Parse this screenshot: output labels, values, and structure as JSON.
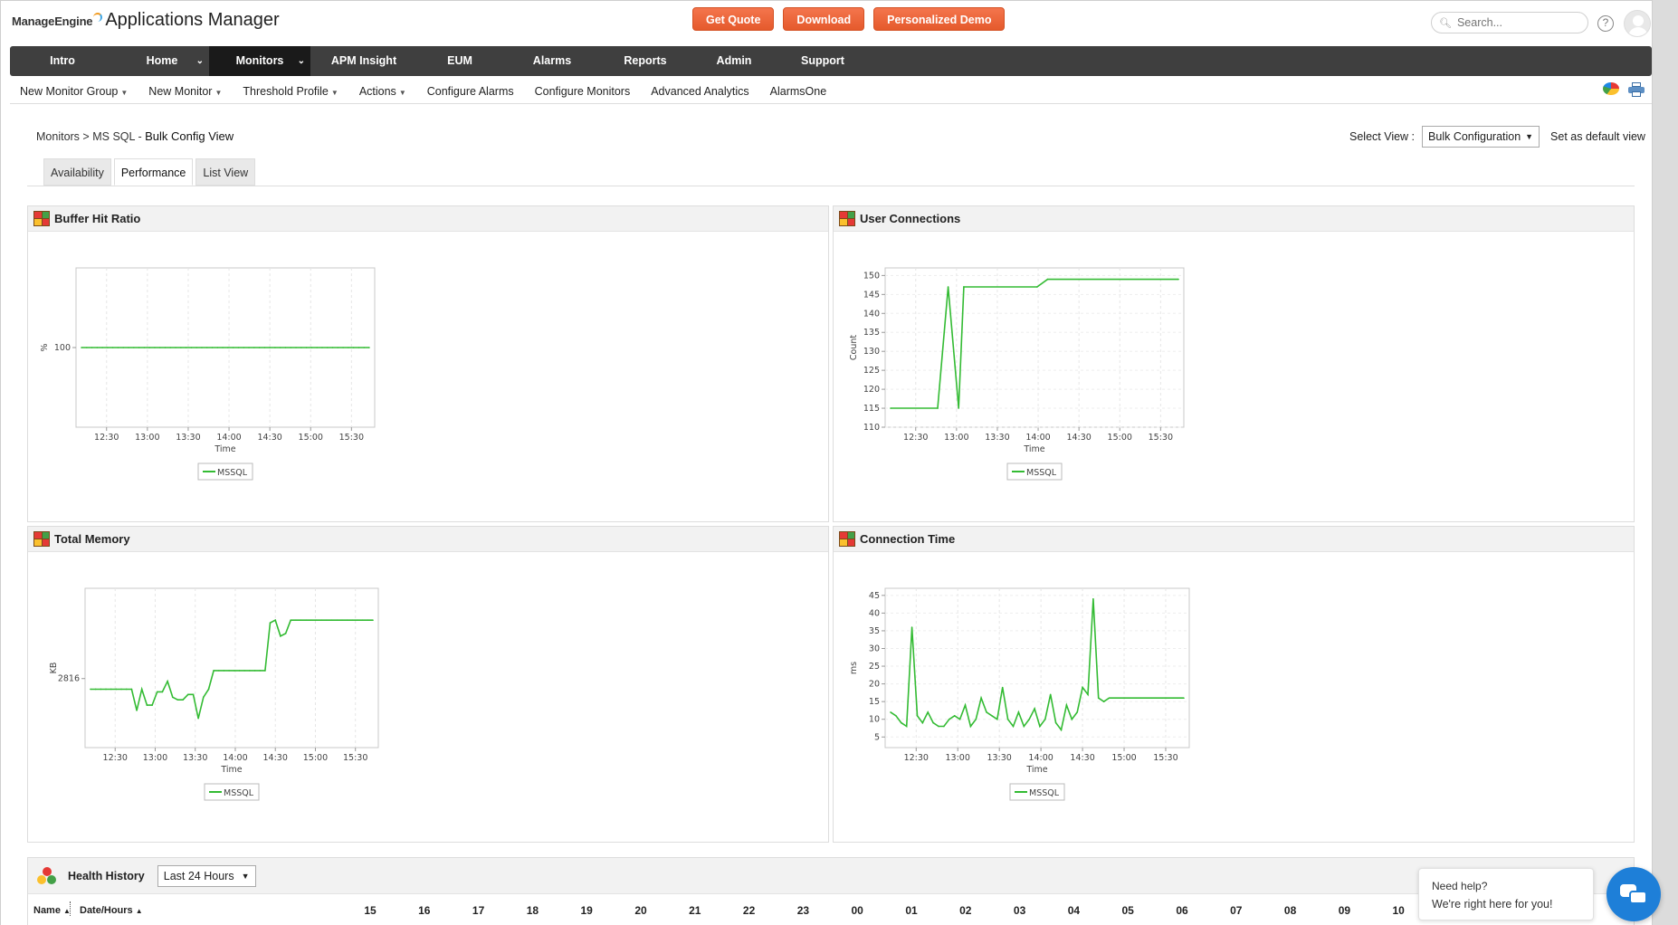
{
  "header": {
    "brand_company": "ManageEngine",
    "brand_product": "Applications Manager",
    "buttons": [
      "Get Quote",
      "Download",
      "Personalized Demo"
    ],
    "search_placeholder": "Search...",
    "help_glyph": "?",
    "accent_color": "#e55a2c"
  },
  "main_nav": [
    {
      "label": "Intro",
      "active": false,
      "chevron": false
    },
    {
      "label": "Home",
      "active": false,
      "chevron": true
    },
    {
      "label": "Monitors",
      "active": true,
      "chevron": true
    },
    {
      "label": "APM Insight",
      "active": false,
      "chevron": false
    },
    {
      "label": "EUM",
      "active": false,
      "chevron": false
    },
    {
      "label": "Alarms",
      "active": false,
      "chevron": false
    },
    {
      "label": "Reports",
      "active": false,
      "chevron": false
    },
    {
      "label": "Admin",
      "active": false,
      "chevron": false
    },
    {
      "label": "Support",
      "active": false,
      "chevron": false
    }
  ],
  "sub_nav": [
    {
      "label": "New Monitor Group",
      "dropdown": true
    },
    {
      "label": "New Monitor",
      "dropdown": true
    },
    {
      "label": "Threshold Profile",
      "dropdown": true
    },
    {
      "label": "Actions",
      "dropdown": true
    },
    {
      "label": "Configure Alarms",
      "dropdown": false
    },
    {
      "label": "Configure Monitors",
      "dropdown": false
    },
    {
      "label": "Advanced Analytics",
      "dropdown": false
    },
    {
      "label": "AlarmsOne",
      "dropdown": false
    }
  ],
  "breadcrumb": {
    "root": "Monitors",
    "separator": ">",
    "type": "MS SQL",
    "dash": "-",
    "page": "Bulk Config View"
  },
  "view_select": {
    "label": "Select View :",
    "value": "Bulk Configuration",
    "default_link": "Set as default view"
  },
  "tabs": [
    {
      "label": "Availability",
      "active": false
    },
    {
      "label": "Performance",
      "active": true
    },
    {
      "label": "List View",
      "active": false
    }
  ],
  "health_history": {
    "title": "Health History",
    "period": "Last 24 Hours",
    "col_name": "Name",
    "col_date": "Date/Hours",
    "hours": [
      "15",
      "16",
      "17",
      "18",
      "19",
      "20",
      "21",
      "22",
      "23",
      "00",
      "01",
      "02",
      "03",
      "04",
      "05",
      "06",
      "07",
      "08",
      "09",
      "10"
    ]
  },
  "help_widget": {
    "line1": "Need help?",
    "line2": "We're right here for you!"
  },
  "chart_data": [
    {
      "type": "line",
      "title": "Buffer Hit Ratio",
      "ylabel": "%",
      "xlabel": "Time",
      "x_ticks": [
        "12:30",
        "13:00",
        "13:30",
        "14:00",
        "14:30",
        "15:00",
        "15:30"
      ],
      "y_ticks": [
        100
      ],
      "ylim": [
        60,
        140
      ],
      "series": [
        {
          "name": "MSSQL",
          "color": "#33bb33",
          "x": [
            0,
            1,
            2,
            3,
            4,
            5,
            6,
            7,
            8,
            9,
            10,
            11,
            12,
            13,
            14,
            15,
            16,
            17,
            18,
            19,
            20,
            21,
            22,
            23,
            24,
            25,
            26,
            27,
            28,
            29,
            30,
            31,
            32,
            33,
            34,
            35,
            36,
            37,
            38,
            39,
            40,
            41,
            42,
            43,
            44,
            45,
            46,
            47,
            48,
            49,
            50,
            51,
            52,
            53,
            54,
            55
          ],
          "y": [
            100,
            100,
            100,
            100,
            100,
            100,
            100,
            100,
            100,
            100,
            100,
            100,
            100,
            100,
            100,
            100,
            100,
            100,
            100,
            100,
            100,
            100,
            100,
            100,
            100,
            100,
            100,
            100,
            100,
            100,
            100,
            100,
            100,
            100,
            100,
            100,
            100,
            100,
            100,
            100,
            100,
            100,
            100,
            100,
            100,
            100,
            100,
            100,
            100,
            100,
            100,
            100,
            100,
            100,
            100,
            100
          ]
        }
      ]
    },
    {
      "type": "line",
      "title": "User Connections",
      "ylabel": "Count",
      "xlabel": "Time",
      "x_ticks": [
        "12:30",
        "13:00",
        "13:30",
        "14:00",
        "14:30",
        "15:00",
        "15:30"
      ],
      "y_ticks": [
        110,
        115,
        120,
        125,
        130,
        135,
        140,
        145,
        150
      ],
      "ylim": [
        110,
        152
      ],
      "series": [
        {
          "name": "MSSQL",
          "color": "#33bb33",
          "x": [
            0,
            9,
            11,
            13,
            14,
            28,
            30,
            55
          ],
          "y": [
            115,
            115,
            147,
            115,
            147,
            147,
            149,
            149
          ]
        }
      ]
    },
    {
      "type": "line",
      "title": "Total Memory",
      "ylabel": "KB",
      "xlabel": "Time",
      "x_ticks": [
        "12:30",
        "13:00",
        "13:30",
        "14:00",
        "14:30",
        "15:00",
        "15:30"
      ],
      "y_ticks": [
        2816
      ],
      "ylim": [
        2790,
        2850
      ],
      "series": [
        {
          "name": "MSSQL",
          "color": "#33bb33",
          "x": [
            0,
            1,
            2,
            3,
            4,
            5,
            6,
            7,
            8,
            9,
            10,
            11,
            12,
            13,
            14,
            15,
            16,
            17,
            18,
            19,
            20,
            21,
            22,
            23,
            24,
            25,
            26,
            27,
            28,
            29,
            30,
            31,
            32,
            33,
            34,
            35,
            36,
            37,
            38,
            39,
            40,
            41,
            42,
            43,
            44,
            45,
            46,
            47,
            48,
            49,
            50,
            51,
            52,
            53,
            54,
            55
          ],
          "y": [
            2812,
            2812,
            2812,
            2812,
            2812,
            2812,
            2812,
            2812,
            2812,
            2804,
            2812,
            2806,
            2806,
            2811,
            2811,
            2815,
            2809,
            2808,
            2808,
            2810,
            2810,
            2801,
            2809,
            2812,
            2819,
            2819,
            2819,
            2819,
            2819,
            2819,
            2819,
            2819,
            2819,
            2819,
            2819,
            2837,
            2838,
            2832,
            2833,
            2838,
            2838,
            2838,
            2838,
            2838,
            2838,
            2838,
            2838,
            2838,
            2838,
            2838,
            2838,
            2838,
            2838,
            2838,
            2838,
            2838
          ]
        }
      ]
    },
    {
      "type": "line",
      "title": "Connection Time",
      "ylabel": "ms",
      "xlabel": "Time",
      "x_ticks": [
        "12:30",
        "13:00",
        "13:30",
        "14:00",
        "14:30",
        "15:00",
        "15:30"
      ],
      "y_ticks": [
        5,
        10,
        15,
        20,
        25,
        30,
        35,
        40,
        45
      ],
      "ylim": [
        2,
        47
      ],
      "series": [
        {
          "name": "MSSQL",
          "color": "#33bb33",
          "x": [
            0,
            1,
            2,
            3,
            4,
            5,
            6,
            7,
            8,
            9,
            10,
            11,
            12,
            13,
            14,
            15,
            16,
            17,
            18,
            19,
            20,
            21,
            22,
            23,
            24,
            25,
            26,
            27,
            28,
            29,
            30,
            31,
            32,
            33,
            34,
            35,
            36,
            37,
            38,
            39,
            40,
            41,
            42,
            43,
            44,
            45,
            46,
            47,
            48,
            49,
            50,
            51,
            52,
            53,
            54,
            55
          ],
          "y": [
            12,
            11,
            9,
            8,
            36,
            11,
            9,
            12,
            9,
            8,
            8,
            10,
            11,
            10,
            14,
            8,
            10,
            16,
            12,
            11,
            10,
            19,
            10,
            8,
            12,
            8,
            10,
            13,
            8,
            10,
            17,
            9,
            7,
            14,
            10,
            12,
            19,
            17,
            44,
            16,
            15,
            16,
            16,
            16,
            16,
            16,
            16,
            16,
            16,
            16,
            16,
            16,
            16,
            16,
            16,
            16
          ]
        }
      ]
    }
  ]
}
